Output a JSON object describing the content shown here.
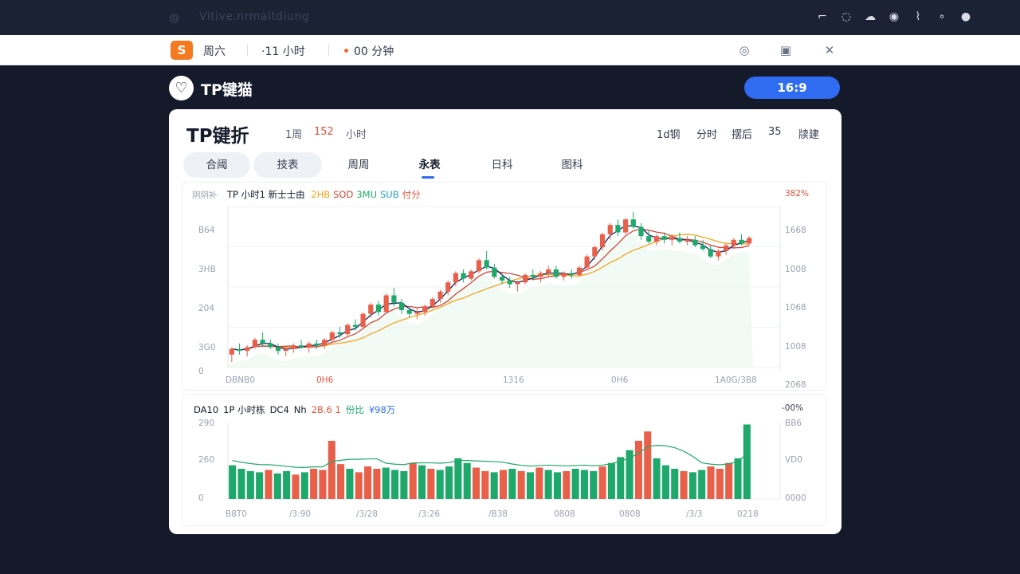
{
  "window": {
    "url_text": "Vitive.nrmaitdiung",
    "sys_icons": [
      "pen-icon",
      "drop-icon",
      "cloud-icon",
      "location-icon",
      "wifi-icon",
      "dot-icon",
      "power-icon"
    ]
  },
  "statusbar": {
    "badge": "S",
    "day": "周六",
    "hours": "·11 小时",
    "minutes": "00 分钟"
  },
  "brand": {
    "name": "TP键猫",
    "ratio": "16:9"
  },
  "card": {
    "title": "TP键折",
    "meta": [
      "1周",
      "152",
      "小时"
    ],
    "right_meta": [
      "1d钢",
      "分时",
      "摆后",
      "35",
      "牍建"
    ],
    "tabs": [
      "合阈",
      "技表",
      "周周",
      "永表",
      "日科",
      "图科"
    ],
    "active_tab": 3
  },
  "colors": {
    "up": "#e8604a",
    "down": "#1fa86b",
    "ma1": "#f0a51e",
    "ma2": "#d0463a",
    "ma3": "#1b2f63",
    "accent": "#2f6cf2"
  },
  "price_panel": {
    "corner_label": "阴阴补",
    "legend_title": "TP 小时1 新士士由",
    "legend_items": [
      {
        "text": "2HB",
        "color": "#f0a51e"
      },
      {
        "text": "SOD",
        "color": "#d0463a"
      },
      {
        "text": "3MU",
        "color": "#1fa86b"
      },
      {
        "text": "SUB",
        "color": "#28a3c2"
      },
      {
        "text": "付分",
        "color": "#e6533c"
      }
    ],
    "right_top": "382%",
    "y_left": [
      "B64",
      "3HB",
      "204",
      "3G0",
      "0"
    ],
    "y_right": [
      "1668",
      "1008",
      "1068",
      "1008",
      "2068"
    ],
    "x_labels": [
      "DBNB0",
      "0H6",
      "1316",
      "0H6",
      "1A0G/3B8"
    ]
  },
  "volume_panel": {
    "caption": [
      {
        "text": "DA10",
        "color": "#151b2b"
      },
      {
        "text": "1P 小时栋",
        "color": "#151b2b"
      },
      {
        "text": "DC4",
        "color": "#151b2b"
      },
      {
        "text": "Nh",
        "color": "#151b2b"
      },
      {
        "text": "2B.6 1",
        "color": "#e6533c"
      },
      {
        "text": "份比",
        "color": "#1fa86b"
      },
      {
        "text": "¥98万",
        "color": "#2f6cf2"
      }
    ],
    "right_top": "-00%",
    "y_left": [
      "290",
      "260",
      "0"
    ],
    "y_right": [
      "BB6",
      "VD0",
      "0000"
    ],
    "x_labels": [
      "B8T0",
      "/3:90",
      "/3/28",
      "/3:26",
      "/B38",
      "0808",
      "0808",
      "/3/3",
      "0218"
    ]
  },
  "chart_data": [
    {
      "type": "candlestick",
      "title": "TP 小时1 新士士由",
      "series_names": [
        "2HB",
        "SOD",
        "3MU",
        "SUB"
      ],
      "ohlc": [
        [
          3.0,
          3.4,
          2.6,
          3.3
        ],
        [
          3.3,
          3.6,
          3.0,
          3.2
        ],
        [
          3.2,
          3.5,
          2.9,
          3.4
        ],
        [
          3.4,
          3.9,
          3.3,
          3.8
        ],
        [
          3.8,
          4.2,
          3.4,
          3.6
        ],
        [
          3.6,
          3.8,
          3.3,
          3.4
        ],
        [
          3.4,
          3.6,
          3.0,
          3.2
        ],
        [
          3.2,
          3.4,
          2.9,
          3.3
        ],
        [
          3.3,
          3.6,
          3.1,
          3.5
        ],
        [
          3.5,
          3.8,
          3.3,
          3.4
        ],
        [
          3.4,
          3.7,
          3.1,
          3.6
        ],
        [
          3.6,
          3.8,
          3.3,
          3.5
        ],
        [
          3.5,
          3.9,
          3.3,
          3.8
        ],
        [
          3.8,
          4.3,
          3.6,
          4.2
        ],
        [
          4.2,
          4.5,
          3.9,
          4.1
        ],
        [
          4.1,
          4.7,
          4.0,
          4.6
        ],
        [
          4.6,
          4.9,
          4.3,
          4.5
        ],
        [
          4.5,
          5.3,
          4.4,
          5.2
        ],
        [
          5.2,
          5.8,
          5.0,
          5.7
        ],
        [
          5.7,
          5.9,
          5.1,
          5.3
        ],
        [
          5.3,
          6.3,
          5.2,
          6.2
        ],
        [
          6.2,
          6.6,
          5.6,
          5.8
        ],
        [
          5.8,
          6.0,
          5.2,
          5.4
        ],
        [
          5.4,
          5.6,
          5.0,
          5.2
        ],
        [
          5.2,
          5.5,
          4.9,
          5.3
        ],
        [
          5.3,
          5.7,
          5.1,
          5.6
        ],
        [
          5.6,
          6.1,
          5.5,
          6.0
        ],
        [
          6.0,
          6.5,
          5.8,
          6.4
        ],
        [
          6.4,
          7.0,
          6.2,
          6.9
        ],
        [
          6.9,
          7.5,
          6.7,
          7.4
        ],
        [
          7.4,
          7.6,
          6.9,
          7.1
        ],
        [
          7.1,
          7.6,
          7.0,
          7.5
        ],
        [
          7.5,
          8.2,
          7.4,
          8.1
        ],
        [
          8.1,
          8.6,
          7.6,
          7.7
        ],
        [
          7.7,
          7.9,
          7.1,
          7.2
        ],
        [
          7.2,
          7.4,
          6.8,
          7.0
        ],
        [
          7.0,
          7.2,
          6.6,
          6.8
        ],
        [
          6.8,
          7.0,
          6.4,
          6.9
        ],
        [
          6.9,
          7.4,
          6.8,
          7.3
        ],
        [
          7.3,
          7.6,
          7.0,
          7.2
        ],
        [
          7.2,
          7.5,
          6.9,
          7.4
        ],
        [
          7.4,
          7.8,
          7.2,
          7.6
        ],
        [
          7.6,
          7.8,
          7.1,
          7.2
        ],
        [
          7.2,
          7.5,
          7.0,
          7.4
        ],
        [
          7.4,
          7.6,
          7.1,
          7.3
        ],
        [
          7.3,
          7.8,
          7.2,
          7.7
        ],
        [
          7.7,
          8.4,
          7.6,
          8.3
        ],
        [
          8.3,
          8.9,
          8.1,
          8.8
        ],
        [
          8.8,
          9.6,
          8.6,
          9.5
        ],
        [
          9.5,
          10.1,
          9.2,
          10.0
        ],
        [
          10.0,
          10.3,
          9.4,
          9.6
        ],
        [
          9.6,
          10.4,
          9.5,
          10.3
        ],
        [
          10.3,
          10.7,
          9.8,
          9.9
        ],
        [
          9.9,
          10.1,
          9.2,
          9.4
        ],
        [
          9.4,
          9.7,
          9.0,
          9.1
        ],
        [
          9.1,
          9.5,
          8.9,
          9.4
        ],
        [
          9.4,
          9.6,
          9.0,
          9.2
        ],
        [
          9.2,
          9.5,
          8.9,
          9.3
        ],
        [
          9.3,
          9.6,
          9.0,
          9.1
        ],
        [
          9.1,
          9.4,
          8.9,
          9.2
        ],
        [
          9.2,
          9.4,
          8.8,
          8.9
        ],
        [
          8.9,
          9.2,
          8.6,
          8.7
        ],
        [
          8.7,
          8.9,
          8.2,
          8.3
        ],
        [
          8.3,
          8.7,
          8.1,
          8.6
        ],
        [
          8.6,
          9.0,
          8.4,
          8.9
        ],
        [
          8.9,
          9.3,
          8.7,
          9.2
        ],
        [
          9.2,
          9.5,
          8.9,
          9.0
        ],
        [
          9.0,
          9.4,
          8.9,
          9.3
        ]
      ]
    },
    {
      "type": "bar",
      "title": "DA10 1P 小时栋 DC4 Nh",
      "values": [
        58,
        52,
        48,
        46,
        50,
        44,
        48,
        42,
        46,
        52,
        50,
        100,
        60,
        52,
        46,
        56,
        52,
        54,
        50,
        48,
        62,
        58,
        52,
        50,
        56,
        70,
        62,
        54,
        48,
        46,
        50,
        52,
        48,
        46,
        54,
        50,
        46,
        48,
        52,
        50,
        48,
        56,
        62,
        72,
        84,
        100,
        116,
        70,
        58,
        52,
        48,
        46,
        50,
        56,
        52,
        62,
        70,
        128
      ],
      "up_flags": [
        0,
        0,
        0,
        0,
        1,
        0,
        0,
        1,
        0,
        1,
        1,
        1,
        1,
        0,
        1,
        1,
        1,
        0,
        0,
        0,
        1,
        0,
        1,
        0,
        0,
        0,
        0,
        1,
        1,
        0,
        1,
        0,
        1,
        0,
        1,
        0,
        0,
        1,
        0,
        0,
        0,
        1,
        0,
        0,
        0,
        1,
        1,
        0,
        0,
        0,
        1,
        0,
        0,
        1,
        1,
        1,
        0,
        0
      ]
    }
  ]
}
